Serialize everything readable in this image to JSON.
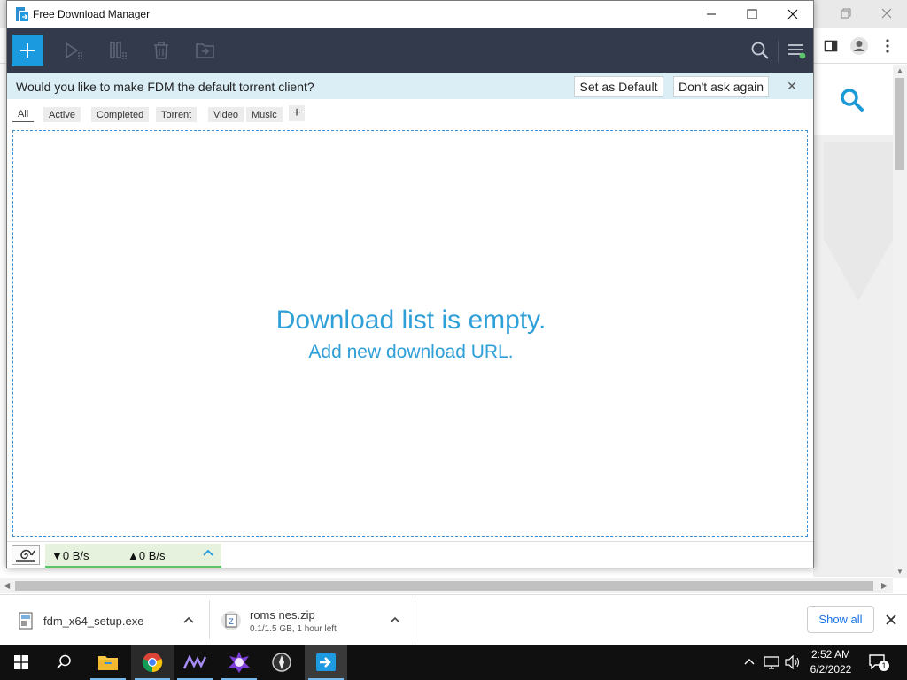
{
  "fdm": {
    "title": "Free Download Manager",
    "notify": {
      "question": "Would you like to make FDM the default torrent client?",
      "set_default": "Set as Default",
      "dont_ask": "Don't ask again",
      "close": "✕"
    },
    "tabs": [
      "All",
      "Active",
      "Completed",
      "Torrent",
      "Video",
      "Music"
    ],
    "add_tab": "+",
    "empty_title": "Download list is empty.",
    "empty_sub": "Add new download URL.",
    "status": {
      "download_speed": "▼0 B/s",
      "upload_speed": "▲0 B/s"
    }
  },
  "downloads": [
    {
      "name": "fdm_x64_setup.exe",
      "status": ""
    },
    {
      "name": "roms nes.zip",
      "status": "0.1/1.5 GB, 1 hour left"
    }
  ],
  "shelf": {
    "show_all": "Show all"
  },
  "clock": {
    "time": "2:52 AM",
    "date": "6/2/2022"
  },
  "notifications": {
    "count": "1"
  },
  "colors": {
    "toolbar": "#323a4c",
    "accent": "#1b9ae0",
    "empty_text": "#2f9fd8",
    "notify_bg": "#dbeef5",
    "speed_bg": "#e6f2de",
    "speed_bar": "#5cc46a"
  },
  "icons": [
    "fdm-logo-icon",
    "add-icon",
    "resume-icon",
    "pause-icon",
    "delete-icon",
    "open-folder-icon",
    "search-icon",
    "menu-icon",
    "snail-icon",
    "chevron-up-icon",
    "windows-start-icon",
    "search-taskbar-icon",
    "file-explorer-icon",
    "chrome-icon",
    "app-icon",
    "notification-icon"
  ]
}
